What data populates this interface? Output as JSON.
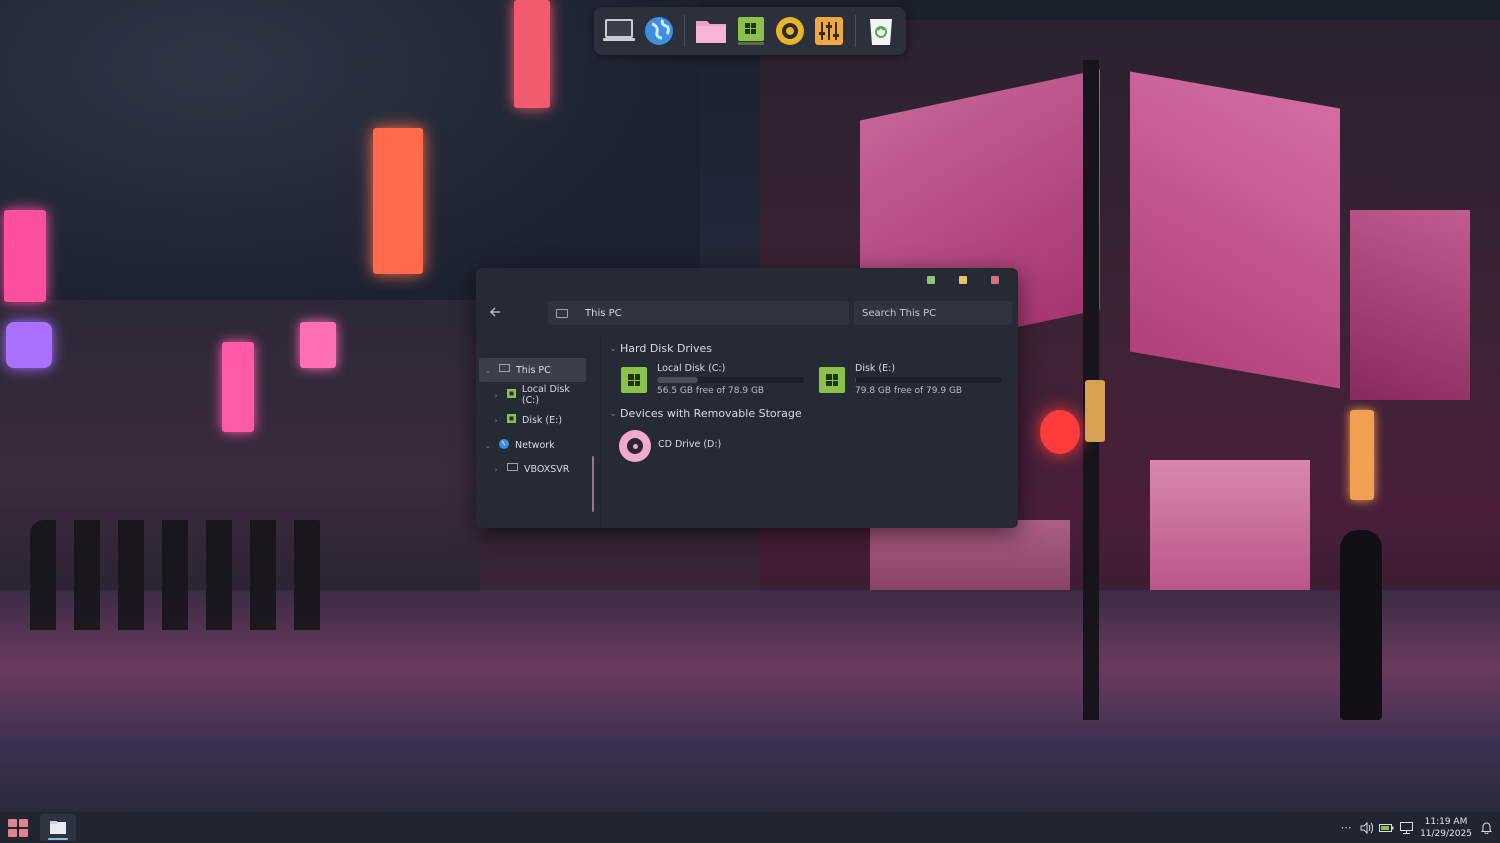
{
  "window": {
    "address": "This PC",
    "search_placeholder": "Search This PC"
  },
  "sidebar": {
    "items": [
      {
        "label": "This PC",
        "icon": "computer-icon"
      },
      {
        "label": "Local Disk (C:)",
        "icon": "drive-icon"
      },
      {
        "label": "Disk (E:)",
        "icon": "drive-icon"
      },
      {
        "label": "Network",
        "icon": "network-icon"
      },
      {
        "label": "VBOXSVR",
        "icon": "computer-icon"
      }
    ]
  },
  "content": {
    "hard_disk_header": "Hard Disk Drives",
    "removable_header": "Devices with Removable Storage",
    "drives": [
      {
        "name": "Local Disk (C:)",
        "free": "56.5 GB free of 78.9 GB",
        "used_fraction": 0.28
      },
      {
        "name": "Disk (E:)",
        "free": "79.8 GB free of 79.9 GB",
        "used_fraction": 0.001
      }
    ],
    "cd": {
      "name": "CD Drive (D:)"
    }
  },
  "dock": {
    "items": [
      "computer-icon",
      "globe-icon",
      "folder-icon",
      "system-monitor-icon",
      "music-player-icon",
      "mixer-icon",
      "trash-icon"
    ]
  },
  "taskbar": {
    "time": "11:19 AM",
    "date": "11/29/2025"
  },
  "colors": {
    "accent_pink": "#f2a8cf",
    "drive_green": "#8bc34a",
    "window_bg": "#252a35",
    "taskbar_bg": "#202531"
  }
}
